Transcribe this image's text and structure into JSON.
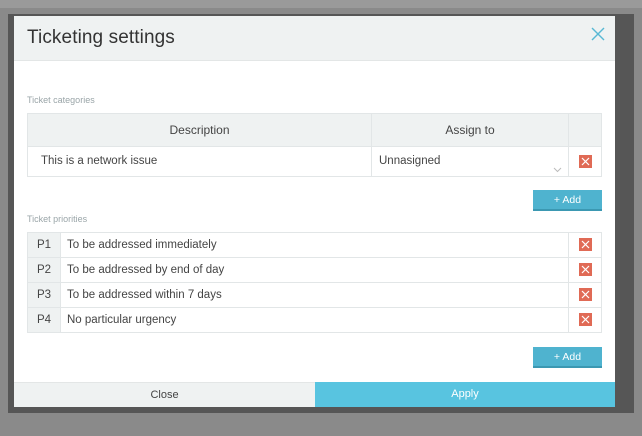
{
  "modal": {
    "title": "Ticketing settings"
  },
  "categories": {
    "label": "Ticket categories",
    "headers": {
      "description": "Description",
      "assign_to": "Assign to"
    },
    "rows": [
      {
        "description": "This is a network issue",
        "assign_to": "Unnasigned"
      }
    ],
    "add_label": "+ Add"
  },
  "priorities": {
    "label": "Ticket priorities",
    "rows": [
      {
        "code": "P1",
        "description": "To be addressed immediately"
      },
      {
        "code": "P2",
        "description": "To be addressed by end of day"
      },
      {
        "code": "P3",
        "description": "To be addressed within 7 days"
      },
      {
        "code": "P4",
        "description": "No particular urgency"
      }
    ],
    "add_label": "+ Add"
  },
  "footer": {
    "close_label": "Close",
    "apply_label": "Apply"
  },
  "colors": {
    "accent": "#58c4e0",
    "add_button": "#4fb3cf",
    "delete": "#e06a55",
    "header_bg": "#eff2f2"
  },
  "icons": {
    "close": "close-icon",
    "delete": "delete-icon",
    "chevron": "chevron-down-icon"
  }
}
